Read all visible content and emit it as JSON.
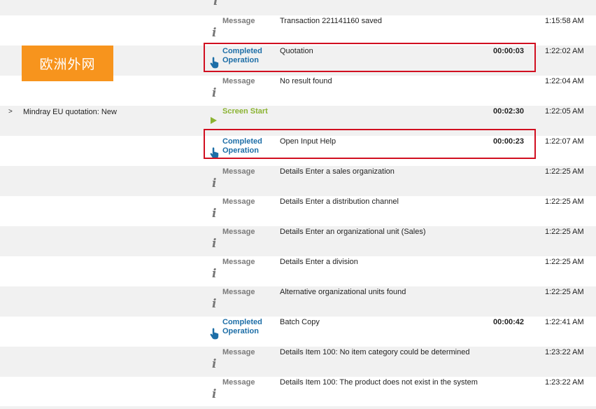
{
  "badge": {
    "text": "欧洲外网"
  },
  "rows": [
    {
      "type": "Message",
      "kind": "message",
      "description": "Transaction 221141160 saved",
      "duration": "",
      "time": "1:15:58 AM",
      "step": "",
      "expander": ""
    },
    {
      "type": "Completed Operation",
      "kind": "operation",
      "description": "Quotation",
      "duration": "00:00:03",
      "time": "1:22:02 AM",
      "step": "",
      "expander": ""
    },
    {
      "type": "Message",
      "kind": "message",
      "description": "No result found",
      "duration": "",
      "time": "1:22:04 AM",
      "step": "",
      "expander": ""
    },
    {
      "type": "Screen Start",
      "kind": "screen",
      "description": "",
      "duration": "00:02:30",
      "time": "1:22:05 AM",
      "step": "Mindray EU quotation: New",
      "expander": ">"
    },
    {
      "type": "Completed Operation",
      "kind": "operation",
      "description": "Open Input Help",
      "duration": "00:00:23",
      "time": "1:22:07 AM",
      "step": "",
      "expander": ""
    },
    {
      "type": "Message",
      "kind": "message",
      "description": "Details Enter a sales organization",
      "duration": "",
      "time": "1:22:25 AM",
      "step": "",
      "expander": ""
    },
    {
      "type": "Message",
      "kind": "message",
      "description": "Details Enter a distribution channel",
      "duration": "",
      "time": "1:22:25 AM",
      "step": "",
      "expander": ""
    },
    {
      "type": "Message",
      "kind": "message",
      "description": "Details Enter an organizational unit (Sales)",
      "duration": "",
      "time": "1:22:25 AM",
      "step": "",
      "expander": ""
    },
    {
      "type": "Message",
      "kind": "message",
      "description": "Details Enter a division",
      "duration": "",
      "time": "1:22:25 AM",
      "step": "",
      "expander": ""
    },
    {
      "type": "Message",
      "kind": "message",
      "description": "Alternative organizational units found",
      "duration": "",
      "time": "1:22:25 AM",
      "step": "",
      "expander": ""
    },
    {
      "type": "Completed Operation",
      "kind": "operation",
      "description": "Batch Copy",
      "duration": "00:00:42",
      "time": "1:22:41 AM",
      "step": "",
      "expander": ""
    },
    {
      "type": "Message",
      "kind": "message",
      "description": "Details Item 100: No item category could be determined",
      "duration": "",
      "time": "1:23:22 AM",
      "step": "",
      "expander": ""
    },
    {
      "type": "Message",
      "kind": "message",
      "description": "Details Item 100: The product does not exist in the system",
      "duration": "",
      "time": "1:23:22 AM",
      "step": "",
      "expander": ""
    }
  ],
  "colors": {
    "highlight": "#d10f20",
    "badge": "#f7941d",
    "operation": "#1d6ea7",
    "screen": "#8bb332",
    "message": "#7a7a7a"
  },
  "icons": {
    "message": "info-icon",
    "operation": "hand-pointer-icon",
    "screen": "play-triangle-icon"
  }
}
